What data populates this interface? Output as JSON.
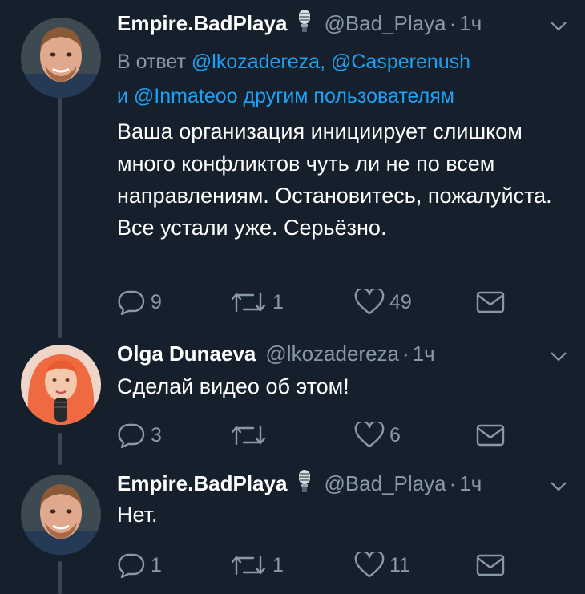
{
  "tweets": [
    {
      "name": "Empire.BadPlaya",
      "handle": "@Bad_Playa",
      "separator": "·",
      "time": "1ч",
      "badge_icon": "microphone-icon",
      "reply_prefix": "В ответ",
      "reply_handle_1": "@lkozadereza,",
      "reply_handle_2": "@Casperenush",
      "reply_conj": "и",
      "reply_handle_3": "@Inmateoo",
      "reply_others": "другим пользователям",
      "text": "Ваша организация инициирует слишком много конфликтов чуть ли не по всем направлениям. Остановитесь, пожалуйста. Все устали уже. Серьёзно.",
      "replies": "9",
      "retweets": "1",
      "likes": "49"
    },
    {
      "name": "Olga Dunaeva",
      "handle": "@lkozadereza",
      "separator": "·",
      "time": "1ч",
      "text": "Сделай видео об этом!",
      "replies": "3",
      "retweets": "",
      "likes": "6"
    },
    {
      "name": "Empire.BadPlaya",
      "handle": "@Bad_Playa",
      "separator": "·",
      "time": "1ч",
      "badge_icon": "microphone-icon",
      "text": "Нет.",
      "replies": "1",
      "retweets": "1",
      "likes": "11"
    }
  ],
  "colors": {
    "background": "#16202c",
    "text": "#ffffff",
    "muted": "#8899a6",
    "link": "#1da1f2",
    "thread_line": "#3a4656"
  }
}
